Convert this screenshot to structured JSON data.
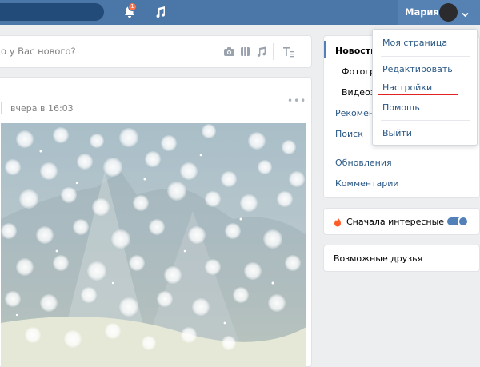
{
  "header": {
    "notification_count": "1",
    "user_name": "Мария"
  },
  "composer": {
    "placeholder": "о у Вас нового?"
  },
  "post": {
    "time": "вчера в 16:03",
    "more": "•••"
  },
  "side_menu": {
    "items": [
      {
        "label": "Новости"
      },
      {
        "label": "Фотогр"
      },
      {
        "label": "Видеоз"
      },
      {
        "label": "Рекомен"
      },
      {
        "label": "Поиск"
      },
      {
        "label": "Обновления"
      },
      {
        "label": "Комментарии"
      }
    ]
  },
  "interesting_first": {
    "label": "Сначала интересные",
    "enabled": true
  },
  "friends": {
    "label": "Возможные друзья"
  },
  "user_dropdown": {
    "items": [
      {
        "label": "Моя страница"
      },
      {
        "label": "Редактировать"
      },
      {
        "label": "Настройки"
      },
      {
        "label": "Помощь"
      },
      {
        "label": "Выйти"
      }
    ],
    "highlighted": "Настройки"
  },
  "colors": {
    "header": "#4a76a8",
    "accent": "#5181b8",
    "link": "#2a5885",
    "highlight_underline": "#e02222"
  }
}
